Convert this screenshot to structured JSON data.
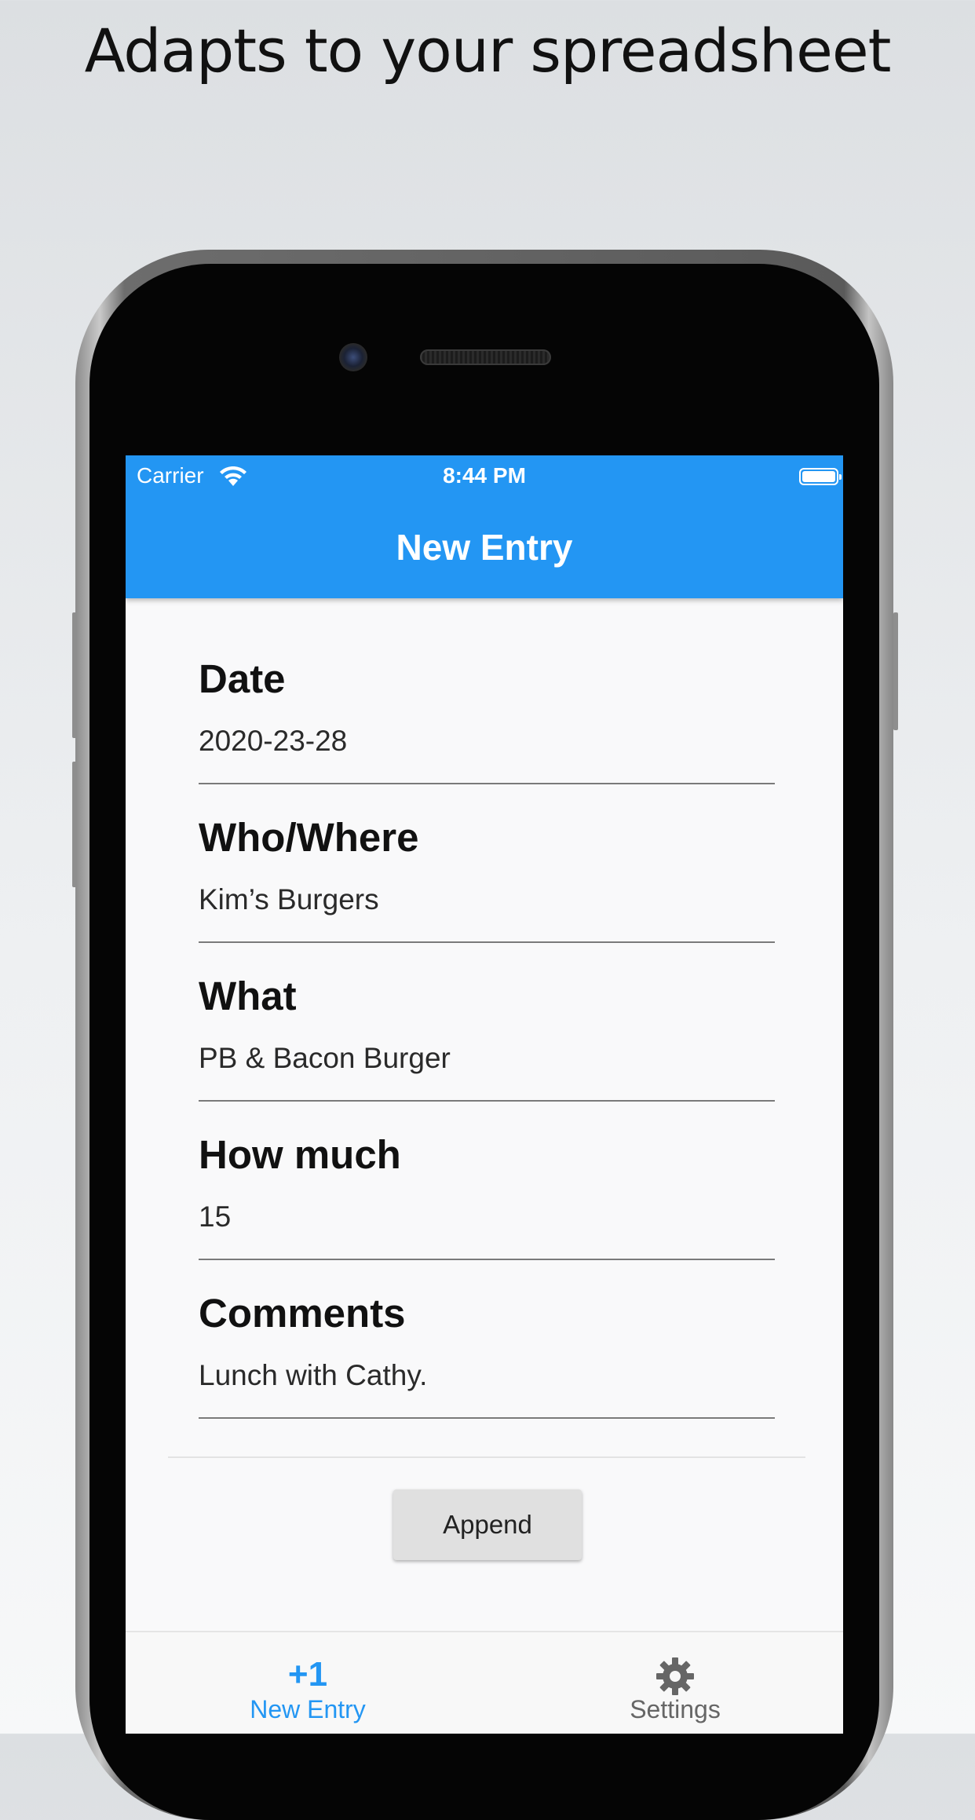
{
  "headline": "Adapts to your spreadsheet",
  "status_bar": {
    "carrier": "Carrier",
    "time": "8:44 PM"
  },
  "app_bar": {
    "title": "New Entry"
  },
  "form": {
    "fields": [
      {
        "label": "Date",
        "value": "2020-23-28"
      },
      {
        "label": "Who/Where",
        "value": "Kim’s Burgers"
      },
      {
        "label": "What",
        "value": "PB & Bacon Burger"
      },
      {
        "label": "How much",
        "value": "15"
      },
      {
        "label": "Comments",
        "value": "Lunch with Cathy."
      }
    ],
    "append_label": "Append"
  },
  "tabs": [
    {
      "icon_text": "+1",
      "label": "New Entry",
      "active": true
    },
    {
      "icon": "gear-icon",
      "label": "Settings",
      "active": false
    }
  ],
  "colors": {
    "accent": "#2396f3",
    "background": "#f9f9fa",
    "inactive_tab": "#666666"
  }
}
